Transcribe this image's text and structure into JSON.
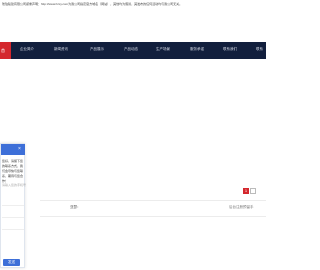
{
  "notice": "琥珀陵建有限公司郑重声明：http://www.hzxy.com为我公司指定官方域名（网站），其他均为假冒，其发布的任何活动均与我公司无关。",
  "nav": {
    "home": "首",
    "items": [
      "企业简介",
      "新闻资讯",
      "产品展示",
      "产品动态",
      "生产场景",
      "服务承诺",
      "联系我们",
      "联系"
    ]
  },
  "pager": {
    "current": "1",
    "next": ""
  },
  "content": {
    "label": "亚瑟：",
    "right": "后台注册预留手"
  },
  "chat": {
    "close": "×",
    "message": "您好，请留下您的联系方式，我们会尽快与您联系，期待与您合作！",
    "hint": "请输入您的手机号",
    "fields": [
      "",
      "",
      ""
    ],
    "send": "发送"
  },
  "colors": {
    "nav_bg": "#121f3d",
    "accent_red": "#d4272d",
    "chat_blue": "#3d6fd8"
  }
}
